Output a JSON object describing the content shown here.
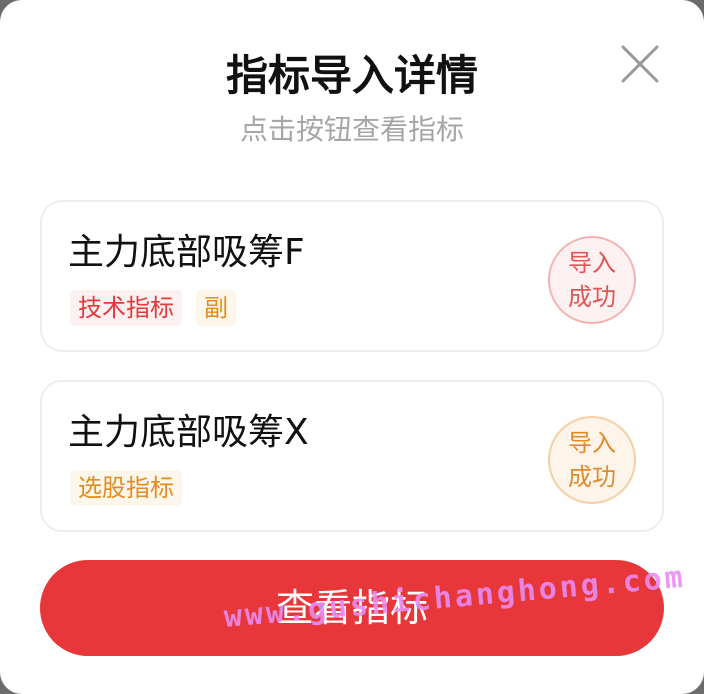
{
  "dialog": {
    "title": "指标导入详情",
    "subtitle": "点击按钮查看指标"
  },
  "items": [
    {
      "name": "主力底部吸筹F",
      "tags": [
        "技术指标",
        "副"
      ],
      "status": "导入\n成功",
      "stamp_color": "#e55454"
    },
    {
      "name": "主力底部吸筹X",
      "tags": [
        "选股指标"
      ],
      "status": "导入\n成功",
      "stamp_color": "#e08a2e"
    }
  ],
  "actions": {
    "view_label": "查看指标"
  },
  "watermark": "www.gushichanghong.com",
  "colors": {
    "primary": "#e8373a",
    "tag_red": "#e23b3b",
    "tag_orange": "#e38c1f"
  },
  "icons": {
    "close": "close-icon"
  }
}
